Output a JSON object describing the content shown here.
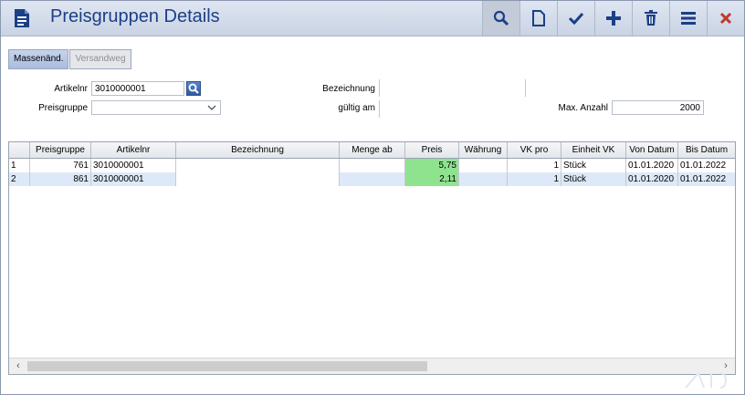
{
  "title": "Preisgruppen Details",
  "toolbar": [
    "search-icon",
    "new-document-icon",
    "checkmark-icon",
    "plus-icon",
    "trash-icon",
    "menu-icon",
    "close-icon"
  ],
  "colors": {
    "accent": "#1b3f86",
    "close": "#c0392b",
    "price_cell": "#8fe38f",
    "selected_row": "#dde9f8"
  },
  "tabs": {
    "massen": "Massenänd.",
    "versand": "Versandweg"
  },
  "form": {
    "artikelnr_label": "Artikelnr",
    "artikelnr_value": "3010000001",
    "preisgruppe_label": "Preisgruppe",
    "preisgruppe_value": "",
    "bezeichnung_label": "Bezeichnung",
    "bezeichnung_value": "",
    "gueltig_label": "gültig am",
    "gueltig_value": "",
    "max_label": "Max. Anzahl",
    "max_value": "2000"
  },
  "grid": {
    "headers": [
      "Preisgruppe",
      "Artikelnr",
      "Bezeichnung",
      "Menge ab",
      "Preis",
      "Währung",
      "VK pro",
      "Einheit VK",
      "Von Datum",
      "Bis Datum"
    ],
    "rows": [
      {
        "idx": "1",
        "preisgruppe": "761",
        "artikelnr": "3010000001",
        "bezeichnung": "",
        "menge": "",
        "preis": "5,75",
        "waehrung": "",
        "vkpro": "1",
        "einheit": "Stück",
        "von": "01.01.2020",
        "bis": "01.01.2022"
      },
      {
        "idx": "2",
        "preisgruppe": "861",
        "artikelnr": "3010000001",
        "bezeichnung": "",
        "menge": "",
        "preis": "2,11",
        "waehrung": "",
        "vkpro": "1",
        "einheit": "Stück",
        "von": "01.01.2020",
        "bis": "01.01.2022"
      }
    ]
  },
  "scroll": {
    "left": "‹",
    "right": "›"
  }
}
